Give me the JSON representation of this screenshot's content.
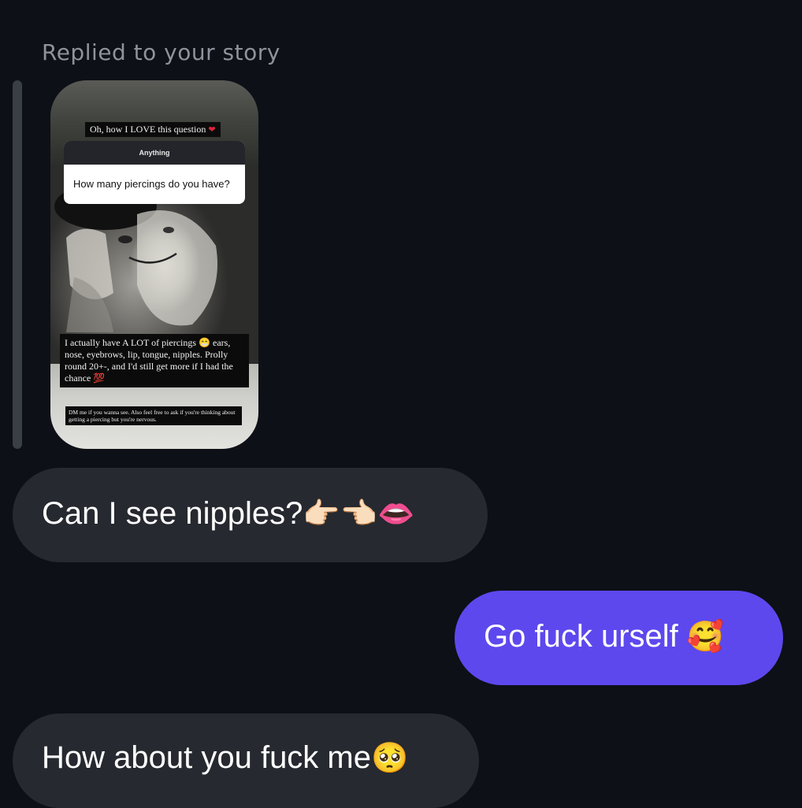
{
  "reply_header": "Replied to your story",
  "story": {
    "caption_top": "Oh, how I LOVE this question",
    "question_title": "Anything",
    "question_text": "How many piercings do you have?",
    "caption_mid": "I actually have A LOT of piercings 😁 ears, nose, eyebrows, lip, tongue, nipples. Prolly round 20+-, and I'd still get more if I had the chance 💯",
    "caption_bottom": "DM me if you wanna see. Also feel free to ask if you're thinking about getting a piercing but you're nervous."
  },
  "messages": [
    {
      "direction": "incoming",
      "text": "Can I see nipples?",
      "emoji": "👉🏻👈🏻👄"
    },
    {
      "direction": "outgoing",
      "text": "Go fuck urself",
      "emoji": "🥰"
    },
    {
      "direction": "incoming",
      "text": "How about you fuck me",
      "emoji": "🥺"
    }
  ],
  "colors": {
    "background": "#0d1016",
    "incoming_bubble": "#26292f",
    "outgoing_bubble": "#5d48ee",
    "muted_text": "#8e939c"
  }
}
